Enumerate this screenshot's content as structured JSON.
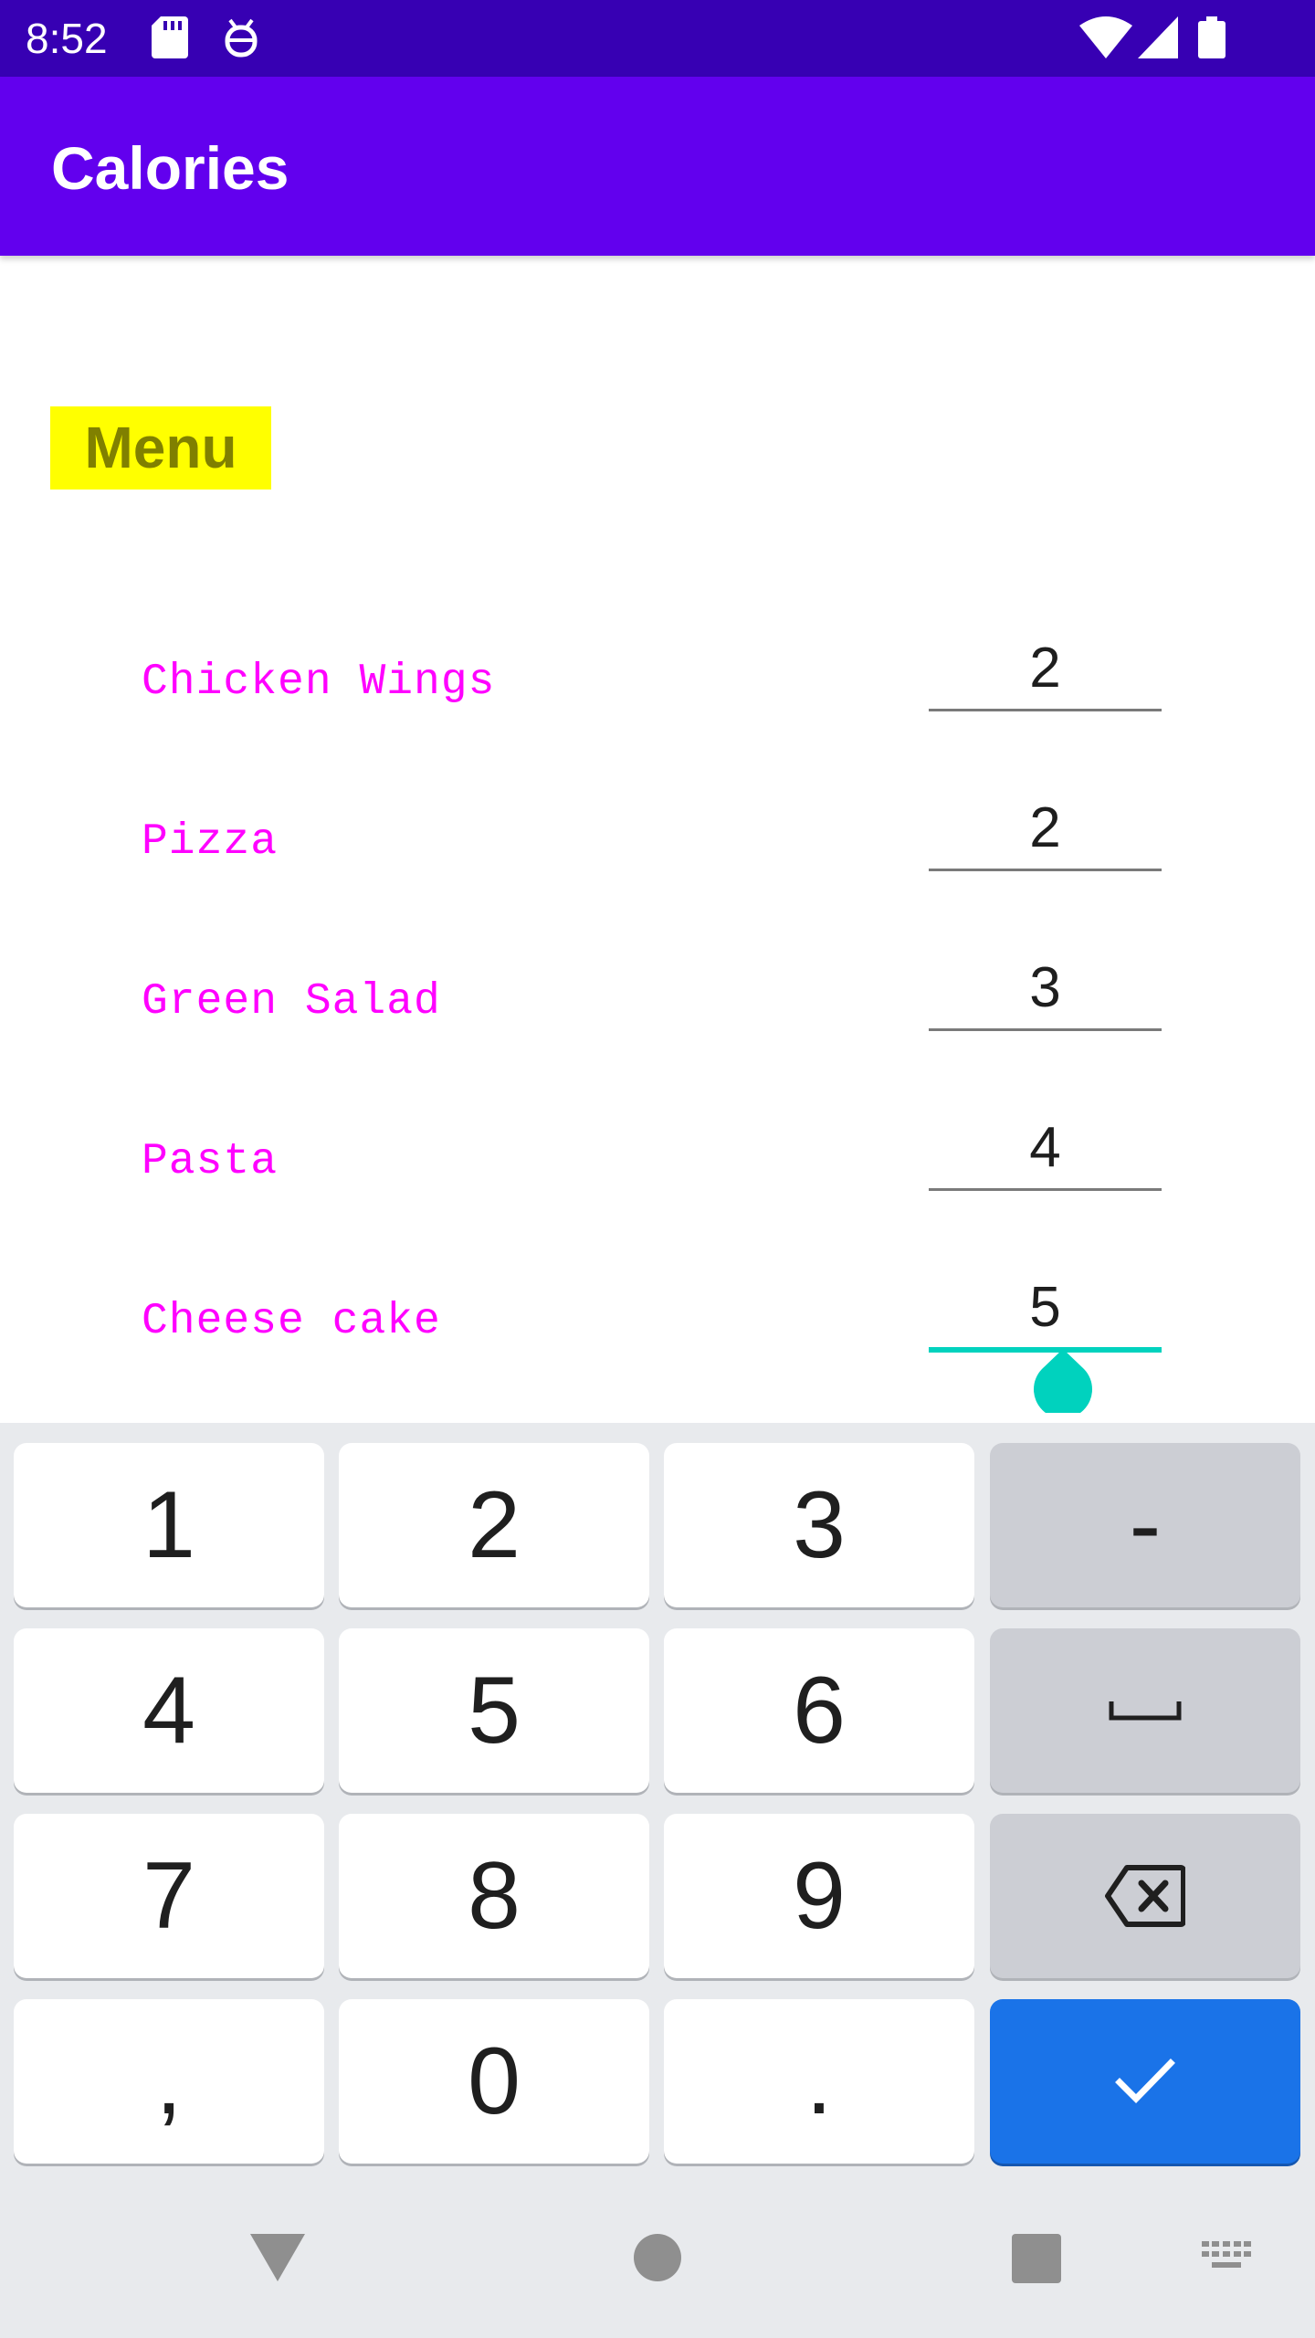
{
  "status_bar": {
    "time": "8:52",
    "icons": [
      "sd-card-icon",
      "android-debug-icon",
      "wifi-icon",
      "cell-signal-icon",
      "battery-icon"
    ]
  },
  "app_bar": {
    "title": "Calories"
  },
  "menu": {
    "heading": "Menu",
    "items": [
      {
        "label": "Chicken Wings",
        "quantity": "2"
      },
      {
        "label": "Pizza",
        "quantity": "2"
      },
      {
        "label": "Green Salad",
        "quantity": "3"
      },
      {
        "label": "Pasta",
        "quantity": "4"
      },
      {
        "label": "Cheese cake",
        "quantity": "5"
      }
    ]
  },
  "keyboard": {
    "rows": [
      [
        "1",
        "2",
        "3",
        "-"
      ],
      [
        "4",
        "5",
        "6",
        "space"
      ],
      [
        "7",
        "8",
        "9",
        "backspace"
      ],
      [
        ",",
        "0",
        ".",
        "done"
      ]
    ],
    "labels": {
      "k1": "1",
      "k2": "2",
      "k3": "3",
      "minus": "-",
      "k4": "4",
      "k5": "5",
      "k6": "6",
      "k7": "7",
      "k8": "8",
      "k9": "9",
      "comma": ",",
      "k0": "0",
      "period": "."
    }
  },
  "colors": {
    "status_bar": "#3700b3",
    "app_bar": "#6200ee",
    "heading_bg": "#ffff00",
    "heading_text": "#808000",
    "item_text": "#ff00ff",
    "focus_accent": "#00d2be",
    "done_key": "#1a73e8"
  }
}
